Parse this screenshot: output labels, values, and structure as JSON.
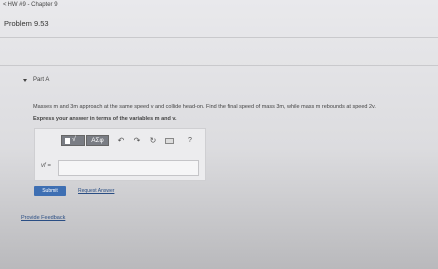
{
  "header": {
    "back_link": "HW #9 - Chapter 9",
    "problem_title": "Problem 9.53"
  },
  "part": {
    "label": "Part A",
    "question": "Masses m and 3m approach at the same speed v and collide head-on. Find the final speed of mass 3m, while mass m rebounds at speed 2v.",
    "instruction": "Express your answer in terms of the variables m and v."
  },
  "answer": {
    "toolbar": {
      "template_icon": "templates-radical-icon",
      "greek_label": "ΑΣφ",
      "undo_icon": "undo-icon",
      "redo_icon": "redo-icon",
      "reset_icon": "reset-icon",
      "keyboard_icon": "keyboard-icon",
      "help_label": "?"
    },
    "variable_label": "vf =",
    "input_value": ""
  },
  "actions": {
    "submit_label": "Submit",
    "request_answer_label": "Request Answer"
  },
  "footer": {
    "feedback_label": "Provide Feedback"
  },
  "colors": {
    "submit": "#3e6fb3",
    "link": "#2a4e84",
    "toolbar_button": "#7a7d84"
  }
}
